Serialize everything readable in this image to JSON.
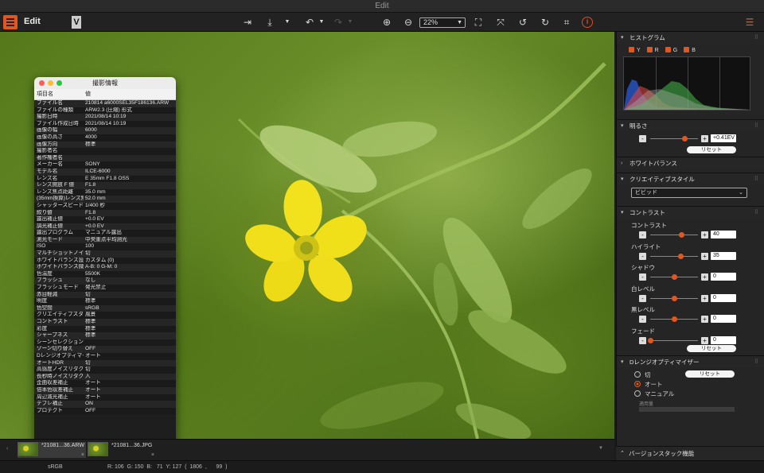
{
  "window": {
    "title": "Edit"
  },
  "toolbar": {
    "app_title": "Edit",
    "v_badge": "V",
    "zoom": "22%",
    "info_glyph": "i"
  },
  "info_panel": {
    "title": "撮影情報",
    "col_key": "項目名",
    "col_value": "値",
    "rows": [
      [
        "ファイル名",
        "210814 a6000SEL35F18613​6.ARW"
      ],
      [
        "ファイルの種類",
        "ARW2.3 (圧縮) 形式"
      ],
      [
        "撮影日時",
        "2021/08/14 10:19"
      ],
      [
        "ファイル作成日時",
        "2021/08/14 10:19"
      ],
      [
        "画像の幅",
        "6000"
      ],
      [
        "画像の高さ",
        "4000"
      ],
      [
        "画像方向",
        "標準"
      ],
      [
        "撮影者名",
        ""
      ],
      [
        "著作権者名",
        ""
      ],
      [
        "メーカー名",
        "SONY"
      ],
      [
        "モデル名",
        "ILCE-6000"
      ],
      [
        "レンズ名",
        "E 35mm F1.8 OSS"
      ],
      [
        "レンズ開放 F 値",
        "F1.8"
      ],
      [
        "レンズ焦点距離",
        "35.0 mm"
      ],
      [
        "(35mm換算)レンズ焦",
        "52.0 mm"
      ],
      [
        "シャッタースピード",
        "1/400 秒"
      ],
      [
        "絞り値",
        "F1.8"
      ],
      [
        "露出補正値",
        "+0.0 EV"
      ],
      [
        "調光補正値",
        "+0.0 EV"
      ],
      [
        "露出プログラム",
        "マニュアル露出"
      ],
      [
        "測光モード",
        "中央重点平均測光"
      ],
      [
        "ISO",
        "100"
      ],
      [
        "マルチショットノイズ",
        "切"
      ],
      [
        "ホワイトバランス設定",
        "カスタム (0)"
      ],
      [
        "ホワイトバランス微調",
        "A-B: 0 G-M: 0"
      ],
      [
        "色温度",
        "5500K"
      ],
      [
        "フラッシュ",
        "なし"
      ],
      [
        "フラッシュモード",
        "発光禁止"
      ],
      [
        "赤目軽減",
        "切"
      ],
      [
        "明度",
        "標準"
      ],
      [
        "色空間",
        "sRGB"
      ],
      [
        "クリエイティブスタイ",
        "風景"
      ],
      [
        "コントラスト",
        "標準"
      ],
      [
        "彩度",
        "標準"
      ],
      [
        "シャープネス",
        "標準"
      ],
      [
        "シーンセレクション",
        ""
      ],
      [
        "ゾーン切り替え",
        "OFF"
      ],
      [
        "Dレンジオプティマイ",
        "オート"
      ],
      [
        "オートHDR",
        "切"
      ],
      [
        "高感度ノイズリダクシ",
        "切"
      ],
      [
        "長秒時ノイズリダクシ",
        "入"
      ],
      [
        "歪曲収差補正",
        "オート"
      ],
      [
        "倍率色収差補正",
        "オート"
      ],
      [
        "周辺減光補正",
        "オート"
      ],
      [
        "デブレ補正",
        "ON"
      ],
      [
        "プロテクト",
        "OFF"
      ]
    ]
  },
  "right_panel": {
    "histogram": {
      "title": "ヒストグラム",
      "channels": [
        "Y",
        "R",
        "G",
        "B"
      ]
    },
    "brightness": {
      "title": "明るさ",
      "value": "+0.41EV",
      "level": 0.73,
      "reset": "リセット"
    },
    "white_balance": {
      "title": "ホワイトバランス"
    },
    "creative_style": {
      "title": "クリエイティブスタイル",
      "selected": "ビビッド"
    },
    "contrast": {
      "title": "コントラスト",
      "sliders": [
        {
          "label": "コントラスト",
          "value": "40",
          "level": 0.66
        },
        {
          "label": "ハイライト",
          "value": "35",
          "level": 0.64
        },
        {
          "label": "シャドウ",
          "value": "0",
          "level": 0.5
        },
        {
          "label": "白レベル",
          "value": "0",
          "level": 0.5
        },
        {
          "label": "黒レベル",
          "value": "0",
          "level": 0.5
        },
        {
          "label": "フェード",
          "value": "0",
          "level": 0.0
        }
      ],
      "reset": "リセット"
    },
    "dro": {
      "title": "Dレンジオプティマイザー",
      "options": [
        "切",
        "オート",
        "マニュアル"
      ],
      "selected": "オート",
      "reset": "リセット",
      "amount_label": "適用量"
    },
    "version_stack": "バージョンスタック機能"
  },
  "filmstrip": {
    "items": [
      {
        "name": "*21081...36.ARW",
        "selected": true
      },
      {
        "name": "*21081...36.JPG",
        "selected": false
      }
    ]
  },
  "status": {
    "color_space": "sRGB",
    "readout": "R: 106  G: 150  B:   71  Y: 127  (  1806  ,      99  )"
  }
}
